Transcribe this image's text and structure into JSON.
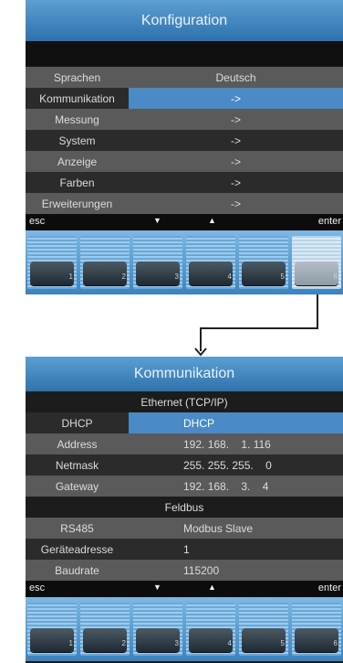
{
  "screen1": {
    "title": "Konfiguration",
    "rows": [
      {
        "label": "Sprachen",
        "value": "Deutsch"
      },
      {
        "label": "Kommunikation",
        "value": "->"
      },
      {
        "label": "Messung",
        "value": "->"
      },
      {
        "label": "System",
        "value": "->"
      },
      {
        "label": "Anzeige",
        "value": "->"
      },
      {
        "label": "Farben",
        "value": "->"
      },
      {
        "label": "Erweiterungen",
        "value": "->"
      }
    ],
    "keybar": {
      "esc": "esc",
      "down": "▼",
      "up": "▲",
      "enter": "enter"
    },
    "fkeys": [
      "1",
      "2",
      "3",
      "4",
      "5",
      "6"
    ]
  },
  "screen2": {
    "title": "Kommunikation",
    "section_ethernet": "Ethernet (TCP/IP)",
    "ethernet_rows": [
      {
        "label": "DHCP",
        "value": "DHCP"
      },
      {
        "label": "Address",
        "value": "192. 168.    1. 116"
      },
      {
        "label": "Netmask",
        "value": "255. 255. 255.    0"
      },
      {
        "label": "Gateway",
        "value": "192. 168.    3.    4"
      }
    ],
    "section_feldbus": "Feldbus",
    "feldbus_rows": [
      {
        "label": "RS485",
        "value": "Modbus Slave"
      },
      {
        "label": "Geräteadresse",
        "value": "1"
      },
      {
        "label": "Baudrate",
        "value": "115200"
      }
    ],
    "keybar": {
      "esc": "esc",
      "down": "▼",
      "up": "▲",
      "enter": "enter"
    },
    "fkeys": [
      "1",
      "2",
      "3",
      "4",
      "5",
      "6"
    ]
  }
}
